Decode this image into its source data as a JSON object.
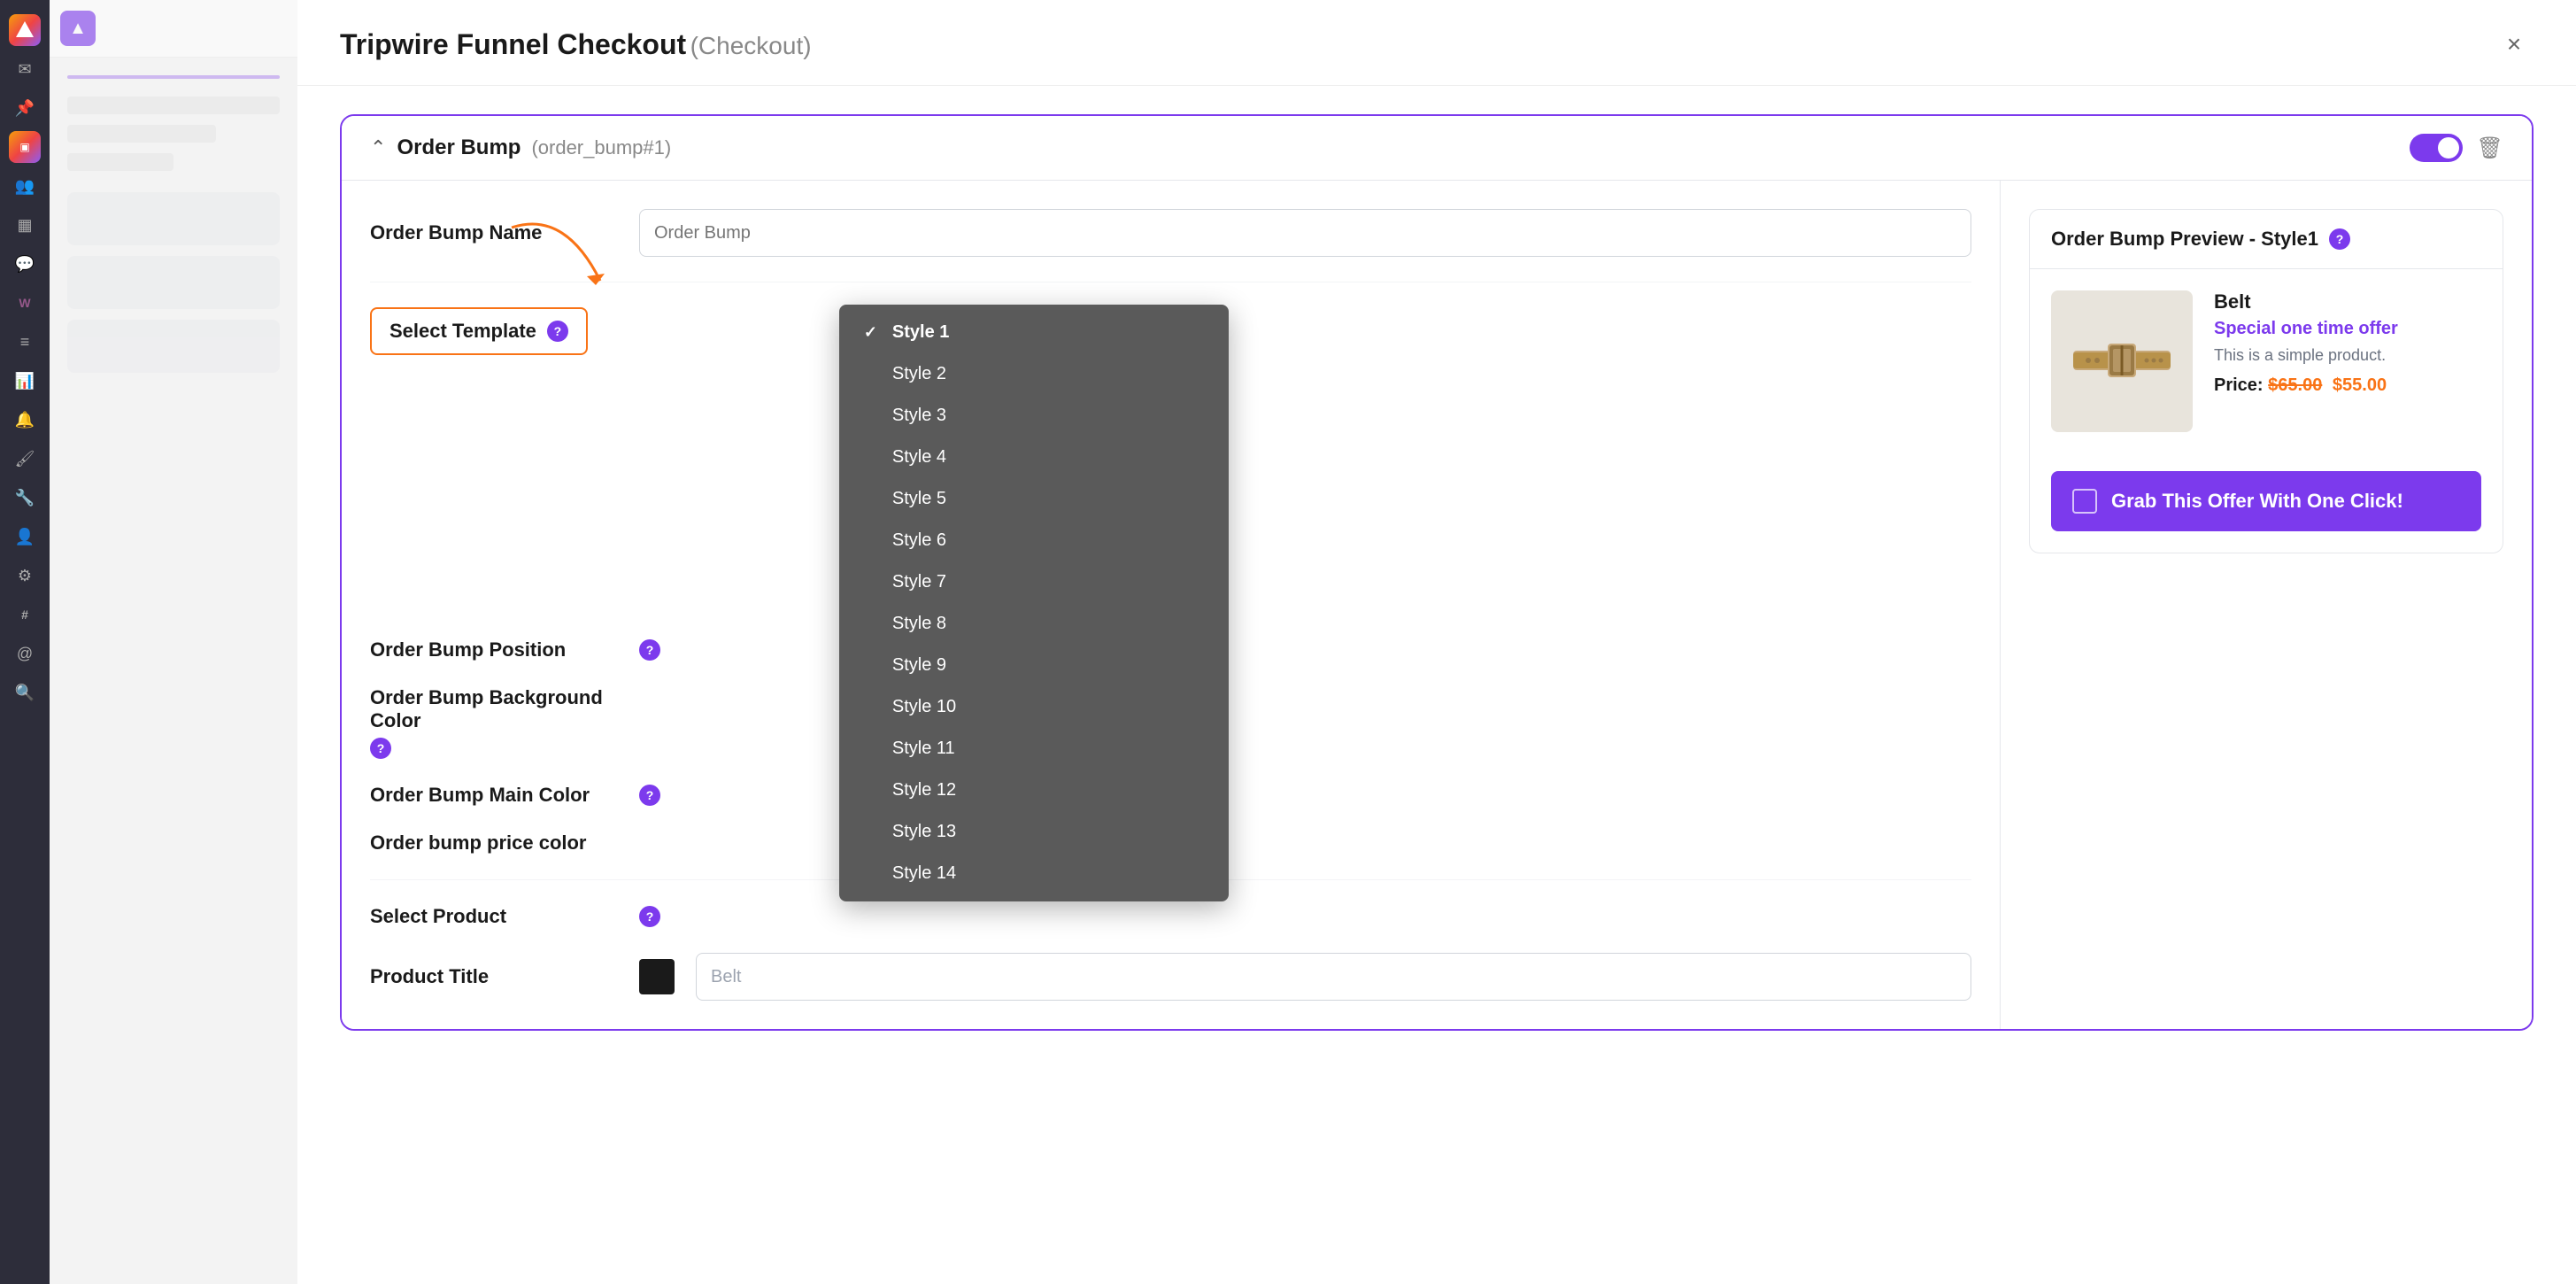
{
  "sidebar": {
    "icons": [
      {
        "name": "home-icon",
        "symbol": "⊞"
      },
      {
        "name": "mail-icon",
        "symbol": "✉"
      },
      {
        "name": "pin-icon",
        "symbol": "📌"
      },
      {
        "name": "gradient-icon",
        "symbol": "▣"
      },
      {
        "name": "users-icon",
        "symbol": "👥"
      },
      {
        "name": "table-icon",
        "symbol": "▦"
      },
      {
        "name": "feedback-icon",
        "symbol": "💬"
      },
      {
        "name": "woo-icon",
        "symbol": "W"
      },
      {
        "name": "list-icon",
        "symbol": "≡"
      },
      {
        "name": "chart-icon",
        "symbol": "📊"
      },
      {
        "name": "bell-icon",
        "symbol": "🔔"
      },
      {
        "name": "brush-icon",
        "symbol": "🖌"
      },
      {
        "name": "wrench-icon",
        "symbol": "🔧"
      },
      {
        "name": "person-icon",
        "symbol": "👤"
      },
      {
        "name": "settings-icon",
        "symbol": "⚙"
      },
      {
        "name": "sort-icon",
        "symbol": "#"
      },
      {
        "name": "at-icon",
        "symbol": "@"
      },
      {
        "name": "search-icon",
        "symbol": "🔍"
      }
    ]
  },
  "modal": {
    "title": "Tripwire Funnel Checkout",
    "subtitle": "(Checkout)",
    "close_label": "×"
  },
  "order_bump_card": {
    "header": {
      "title": "Order Bump",
      "subtitle": "(order_bump#1)",
      "toggle_active": true
    },
    "form": {
      "name_label": "Order Bump Name",
      "name_placeholder": "Order Bump",
      "select_template_label": "Select Template",
      "select_template_help": "?",
      "position_label": "Order Bump Position",
      "position_help": "?",
      "bg_color_label": "Order Bump Background Color",
      "bg_color_help": "?",
      "main_color_label": "Order Bump Main Color",
      "main_color_help": "?",
      "price_color_label": "Order bump price color",
      "select_product_label": "Select Product",
      "select_product_help": "?",
      "product_title_label": "Product Title"
    },
    "dropdown": {
      "items": [
        {
          "label": "Style 1",
          "selected": true
        },
        {
          "label": "Style 2",
          "selected": false
        },
        {
          "label": "Style 3",
          "selected": false
        },
        {
          "label": "Style 4",
          "selected": false
        },
        {
          "label": "Style 5",
          "selected": false
        },
        {
          "label": "Style 6",
          "selected": false
        },
        {
          "label": "Style 7",
          "selected": false
        },
        {
          "label": "Style 8",
          "selected": false
        },
        {
          "label": "Style 9",
          "selected": false
        },
        {
          "label": "Style 10",
          "selected": false
        },
        {
          "label": "Style 11",
          "selected": false
        },
        {
          "label": "Style 12",
          "selected": false
        },
        {
          "label": "Style 13",
          "selected": false
        },
        {
          "label": "Style 14",
          "selected": false
        }
      ]
    },
    "preview": {
      "title": "Order Bump Preview - Style1",
      "help": "?",
      "product_name": "Belt",
      "product_offer": "Special one time offer",
      "product_desc": "This is a simple product.",
      "price_label": "Price:",
      "price_original": "$65.00",
      "price_sale": "$55.00",
      "grab_button_label": "Grab This Offer With One Click!",
      "product_title_value": "Belt"
    }
  }
}
